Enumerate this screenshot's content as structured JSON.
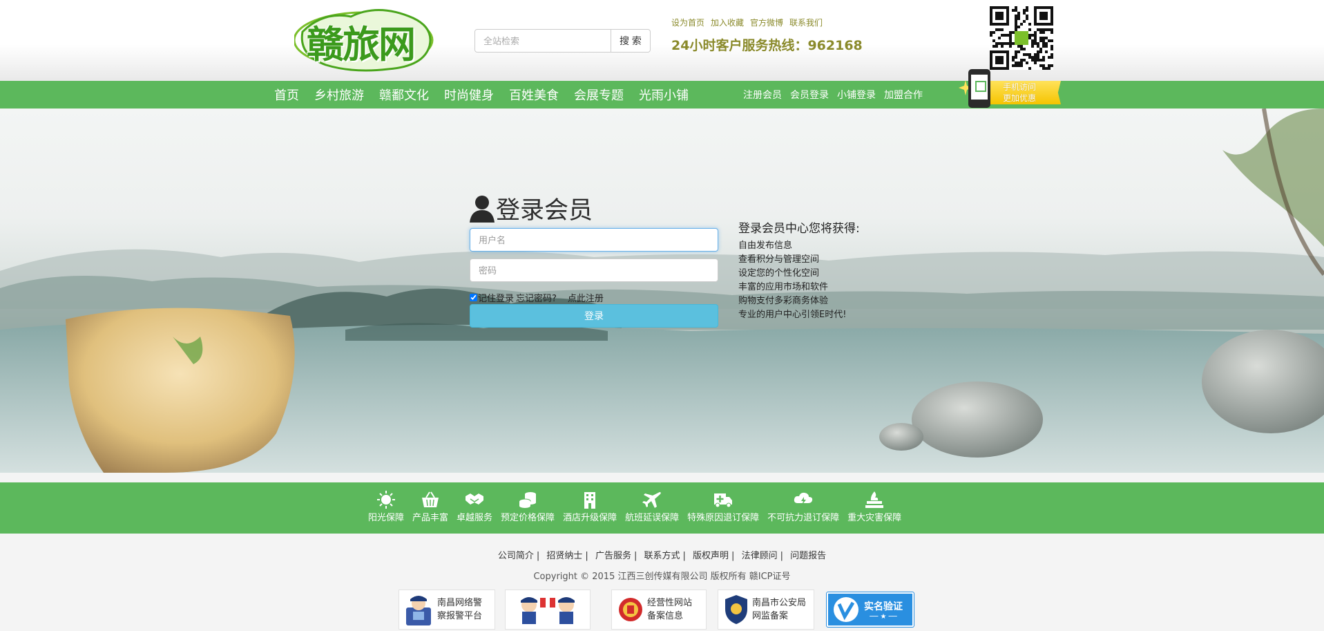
{
  "header": {
    "logo_text": "赣旅网",
    "search": {
      "placeholder": "全站检索",
      "button_label": "搜 索"
    },
    "top_links": [
      "设为首页",
      "加入收藏",
      "官方微博",
      "联系我们"
    ],
    "hotline": "24小时客户服务热线：962168"
  },
  "nav": {
    "main_items": [
      "首页",
      "乡村旅游",
      "赣鄱文化",
      "时尚健身",
      "百姓美食",
      "会展专题",
      "光雨小铺"
    ],
    "user_items": [
      "注册会员",
      "会员登录",
      "小铺登录",
      "加盟合作"
    ],
    "mobile_promo": {
      "line1": "手机访问",
      "line2": "更加优惠"
    }
  },
  "login": {
    "title": "登录会员",
    "username_placeholder": "用户名",
    "password_placeholder": "密码",
    "remember_label": "记住登录",
    "forgot_label": "忘记密码?",
    "register_label": "点此注册",
    "remember_checked": true,
    "submit_label": "登录"
  },
  "benefits": {
    "title": "登录会员中心您将获得:",
    "items": [
      "自由发布信息",
      "查看积分与管理空间",
      "设定您的个性化空间",
      "丰富的应用市场和软件",
      "购物支付多彩商务体验",
      "专业的用户中心引领E时代!"
    ]
  },
  "guarantees": [
    {
      "label": "阳光保障",
      "icon": "sun-icon"
    },
    {
      "label": "产品丰富",
      "icon": "basket-icon"
    },
    {
      "label": "卓越服务",
      "icon": "handshake-icon"
    },
    {
      "label": "预定价格保障",
      "icon": "coins-icon"
    },
    {
      "label": "酒店升级保障",
      "icon": "hotel-icon"
    },
    {
      "label": "航班延误保障",
      "icon": "airplane-icon"
    },
    {
      "label": "特殊原因退订保障",
      "icon": "ambulance-icon"
    },
    {
      "label": "不可抗力退订保障",
      "icon": "storm-cloud-icon"
    },
    {
      "label": "重大灾害保障",
      "icon": "disaster-icon"
    }
  ],
  "footer": {
    "links": [
      "公司简介",
      "招贤纳士",
      "广告服务",
      "联系方式",
      "版权声明",
      "法律顾问",
      "问题报告"
    ],
    "copyright": "Copyright © 2015 江西三创传媒有限公司 版权所有 赣ICP证号",
    "badges": [
      {
        "line1": "南昌网络警",
        "line2": "察报警平台"
      },
      {
        "line1": "",
        "line2": ""
      },
      {
        "line1": "经营性网站",
        "line2": "备案信息"
      },
      {
        "line1": "南昌市公安局",
        "line2": "网监备案"
      },
      {
        "line1": "实名验证",
        "line2": "── ★ ──"
      }
    ]
  },
  "colors": {
    "brand_green": "#5cb85c",
    "login_button": "#5bc0de",
    "hotline_olive": "#8a8a2b",
    "promo_yellow": "#f5c400",
    "verify_blue": "#2a8fe0"
  }
}
